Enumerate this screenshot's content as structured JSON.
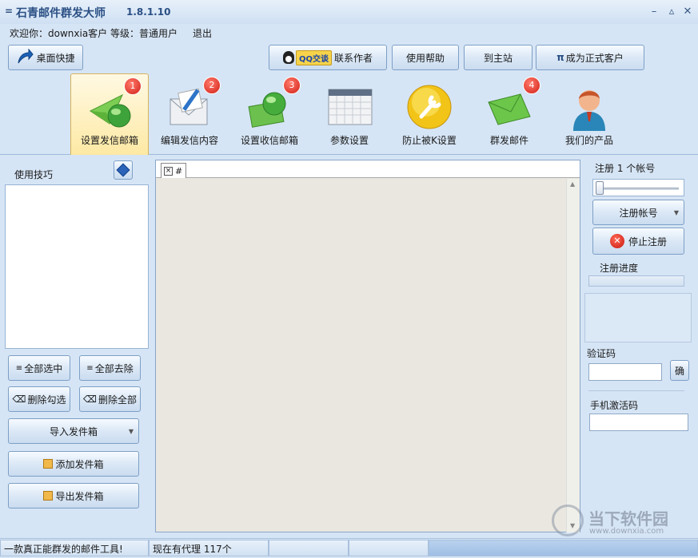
{
  "window": {
    "title": "石青邮件群发大师",
    "version": "1.8.1.10",
    "sys_menu": "=",
    "btn_min": "–",
    "btn_restore": "▵",
    "btn_close": "✕"
  },
  "info": {
    "welcome": "欢迎你：downxia客户",
    "level": "等级：普通用户",
    "logout": "退出"
  },
  "toolbar": {
    "desktop_shortcut": "桌面快捷",
    "qq_badge": "QQ交谈",
    "contact_author": "联系作者",
    "help": "使用帮助",
    "to_site": "到主站",
    "become_official_prefix": "π",
    "become_official": "成为正式客户"
  },
  "tabs": [
    {
      "label": "设置发信邮箱",
      "badge": "1",
      "active": true
    },
    {
      "label": "编辑发信内容",
      "badge": "2"
    },
    {
      "label": "设置收信邮箱",
      "badge": "3"
    },
    {
      "label": "参数设置"
    },
    {
      "label": "防止被K设置"
    },
    {
      "label": "群发邮件",
      "badge": "4"
    },
    {
      "label": "我们的产品"
    }
  ],
  "left": {
    "tips_label": "使用技巧",
    "select_all": "全部选中",
    "remove_all": "全部去除",
    "delete_checked": "删除勾选",
    "delete_all": "删除全部",
    "import_outbox": "导入发件箱",
    "add_outbox": "添加发件箱",
    "export_outbox": "导出发件箱"
  },
  "center": {
    "doc_tab_close": "×",
    "doc_tab_label": "#"
  },
  "right": {
    "reg_count": "注册 1 个帐号",
    "slider_value": 0,
    "register_account": "注册帐号",
    "stop_register": "停止注册",
    "progress_label": "注册进度",
    "captcha_label": "验证码",
    "captcha_confirm": "确",
    "mobile_label": "手机激活码"
  },
  "status": {
    "slogan": "一款真正能群发的邮件工具!",
    "proxy": "现在有代理 117个"
  },
  "watermark": {
    "name": "当下软件园",
    "url": "www.downxia.com"
  }
}
